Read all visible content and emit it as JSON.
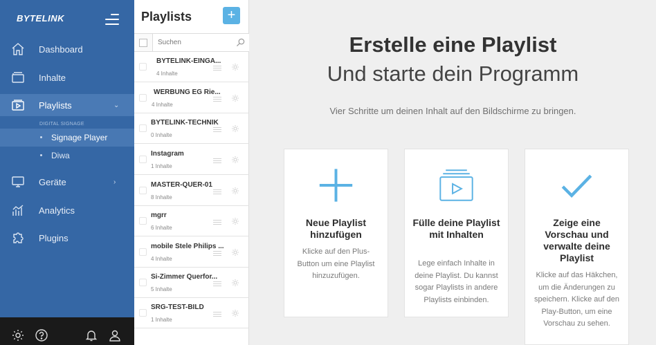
{
  "sidebar": {
    "logo": "BYTELINK",
    "nav": [
      {
        "label": "Dashboard"
      },
      {
        "label": "Inhalte"
      },
      {
        "label": "Playlists"
      },
      {
        "label": "Geräte"
      },
      {
        "label": "Analytics"
      },
      {
        "label": "Plugins"
      }
    ],
    "section_label": "DIGITAL SIGNAGE",
    "sub_items": [
      {
        "label": "Signage Player"
      },
      {
        "label": "Diwa"
      }
    ]
  },
  "playlists": {
    "title": "Playlists",
    "add_label": "+",
    "search_placeholder": "Suchen",
    "items": [
      {
        "name": "BYTELINK-EINGA...",
        "count": "4 Inhalte"
      },
      {
        "name": "WERBUNG EG Rie...",
        "count": "4 Inhalte"
      },
      {
        "name": "BYTELINK-TECHNIK",
        "count": "0 Inhalte"
      },
      {
        "name": "Instagram",
        "count": "1 Inhalte"
      },
      {
        "name": "MASTER-QUER-01",
        "count": "8 Inhalte"
      },
      {
        "name": "mgrr",
        "count": "6 Inhalte"
      },
      {
        "name": "mobile Stele Philips ...",
        "count": "4 Inhalte"
      },
      {
        "name": "Si-Zimmer Querfor...",
        "count": "5 Inhalte"
      },
      {
        "name": "SRG-TEST-BILD",
        "count": "1 Inhalte"
      }
    ]
  },
  "main": {
    "heading": "Erstelle eine Playlist",
    "subheading": "Und starte dein Programm",
    "intro": "Vier Schritte um deinen Inhalt auf den Bildschirme zu bringen.",
    "cards": [
      {
        "title": "Neue Playlist hinzufügen",
        "text": "Klicke auf den Plus-Button um eine Playlist hinzuzufügen.",
        "icon": "plus-icon"
      },
      {
        "title": "Fülle deine Playlist mit Inhalten",
        "text": "Lege einfach Inhalte in deine Playlist. Du kannst sogar Playlists in andere Playlists einbinden.",
        "icon": "play-stack-icon"
      },
      {
        "title": "Zeige eine Vorschau und verwalte deine Playlist",
        "text": "Klicke auf das Häkchen, um die Änderungen zu speichern. Klicke auf den Play-Button, um eine Vorschau zu sehen.",
        "icon": "checkmark-icon"
      }
    ]
  },
  "colors": {
    "sidebar": "#3567a5",
    "accent": "#5bb2e4",
    "footer": "#1a1a1a"
  }
}
